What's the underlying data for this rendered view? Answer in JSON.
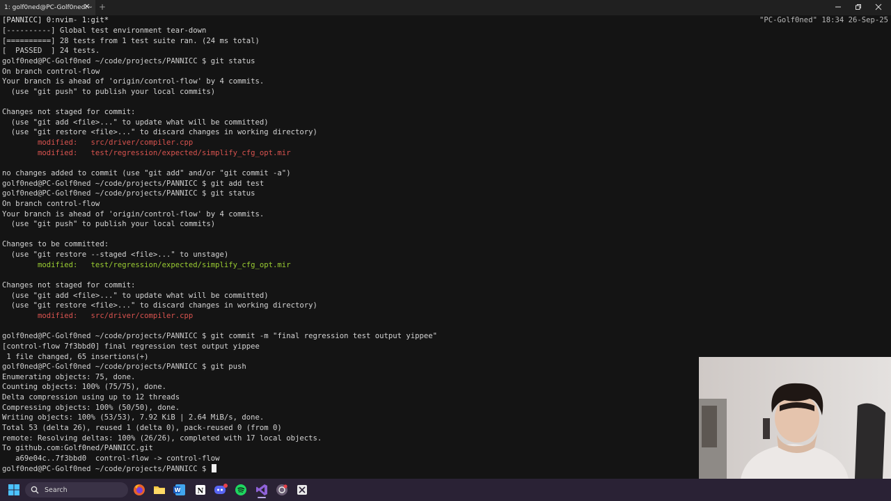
{
  "window": {
    "tab_title": "1: golf0ned@PC-Golf0ned:~",
    "close_glyph": "✕",
    "new_tab_glyph": "+"
  },
  "tmux": {
    "left": "[PANNICC] 0:nvim- 1:git*",
    "right": "\"PC-Golf0ned\" 18:34 26-Sep-25"
  },
  "terminal": {
    "lines": [
      {
        "text": "[----------] Global test environment tear-down"
      },
      {
        "text": "[==========] 28 tests from 1 test suite ran. (24 ms total)"
      },
      {
        "text": "[  PASSED  ] 24 tests."
      },
      {
        "prompt": "golf0ned@PC-Golf0ned ~/code/projects/PANNICC $",
        "cmd": " git status"
      },
      {
        "text": "On branch control-flow"
      },
      {
        "text": "Your branch is ahead of 'origin/control-flow' by 4 commits."
      },
      {
        "text": "  (use \"git push\" to publish your local commits)"
      },
      {
        "text": ""
      },
      {
        "text": "Changes not staged for commit:"
      },
      {
        "text": "  (use \"git add <file>...\" to update what will be committed)"
      },
      {
        "text": "  (use \"git restore <file>...\" to discard changes in working directory)"
      },
      {
        "text": "        modified:   src/driver/compiler.cpp",
        "color": "red"
      },
      {
        "text": "        modified:   test/regression/expected/simplify_cfg_opt.mir",
        "color": "red"
      },
      {
        "text": ""
      },
      {
        "text": "no changes added to commit (use \"git add\" and/or \"git commit -a\")"
      },
      {
        "prompt": "golf0ned@PC-Golf0ned ~/code/projects/PANNICC $",
        "cmd": " git add test"
      },
      {
        "prompt": "golf0ned@PC-Golf0ned ~/code/projects/PANNICC $",
        "cmd": " git status"
      },
      {
        "text": "On branch control-flow"
      },
      {
        "text": "Your branch is ahead of 'origin/control-flow' by 4 commits."
      },
      {
        "text": "  (use \"git push\" to publish your local commits)"
      },
      {
        "text": ""
      },
      {
        "text": "Changes to be committed:"
      },
      {
        "text": "  (use \"git restore --staged <file>...\" to unstage)"
      },
      {
        "text": "        modified:   test/regression/expected/simplify_cfg_opt.mir",
        "color": "green"
      },
      {
        "text": ""
      },
      {
        "text": "Changes not staged for commit:"
      },
      {
        "text": "  (use \"git add <file>...\" to update what will be committed)"
      },
      {
        "text": "  (use \"git restore <file>...\" to discard changes in working directory)"
      },
      {
        "text": "        modified:   src/driver/compiler.cpp",
        "color": "red"
      },
      {
        "text": ""
      },
      {
        "prompt": "golf0ned@PC-Golf0ned ~/code/projects/PANNICC $",
        "cmd": " git commit -m \"final regression test output yippee\""
      },
      {
        "text": "[control-flow 7f3bbd0] final regression test output yippee"
      },
      {
        "text": " 1 file changed, 65 insertions(+)"
      },
      {
        "prompt": "golf0ned@PC-Golf0ned ~/code/projects/PANNICC $",
        "cmd": " git push"
      },
      {
        "text": "Enumerating objects: 75, done."
      },
      {
        "text": "Counting objects: 100% (75/75), done."
      },
      {
        "text": "Delta compression using up to 12 threads"
      },
      {
        "text": "Compressing objects: 100% (50/50), done."
      },
      {
        "text": "Writing objects: 100% (53/53), 7.92 KiB | 2.64 MiB/s, done."
      },
      {
        "text": "Total 53 (delta 26), reused 1 (delta 0), pack-reused 0 (from 0)"
      },
      {
        "text": "remote: Resolving deltas: 100% (26/26), completed with 17 local objects."
      },
      {
        "text": "To github.com:Golf0ned/PANNICC.git"
      },
      {
        "text": "   a69e04c..7f3bbd0  control-flow -> control-flow"
      },
      {
        "prompt": "golf0ned@PC-Golf0ned ~/code/projects/PANNICC $",
        "cmd": " ",
        "cursor": true
      }
    ]
  },
  "taskbar": {
    "search_label": "Search",
    "icons": [
      "windows-start-icon",
      "search-icon",
      "firefox-icon",
      "file-explorer-icon",
      "word-icon",
      "notion-icon",
      "discord-icon",
      "spotify-icon",
      "visual-studio-icon",
      "git-icon",
      "snipping-tool-icon"
    ],
    "accent_color": "#b9a8e6"
  },
  "colors": {
    "terminal_bg": "#141414",
    "modified_unstaged": "#d9534f",
    "modified_staged": "#9acd32",
    "taskbar_bg": "#2a2235"
  }
}
